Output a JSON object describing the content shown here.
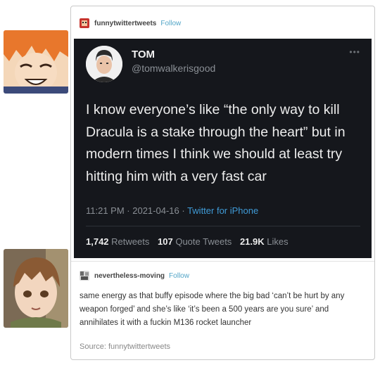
{
  "post": {
    "blog_name": "funnytwittertweets",
    "follow_label": "Follow"
  },
  "tweet": {
    "display_name": "TOM",
    "handle": "@tomwalkerisgood",
    "more": "•••",
    "text": "I know everyone’s like “the only way to kill Dracula is a stake through the heart” but in modern times I think we should at least try hitting him with a very fast car",
    "time": "11:21 PM · 2021-04-16 · ",
    "source": "Twitter for iPhone",
    "retweets_count": "1,742",
    "retweets_label": "Retweets",
    "quotes_count": "107",
    "quotes_label": "Quote Tweets",
    "likes_count": "21.9K",
    "likes_label": "Likes"
  },
  "reblog": {
    "blog_name": "nevertheless-moving",
    "follow_label": "Follow",
    "text": "same energy as that buffy episode where the big bad ‘can’t be hurt by any weapon forged’ and she’s like ‘it’s been a 500 years are you sure’ and annihilates it with a fuckin M136 rocket launcher",
    "source_label": "Source: funnytwittertweets"
  },
  "colors": {
    "tweet_bg": "#15171c",
    "link_blue": "#52a5c7",
    "twitter_blue": "#3f9ad6"
  }
}
